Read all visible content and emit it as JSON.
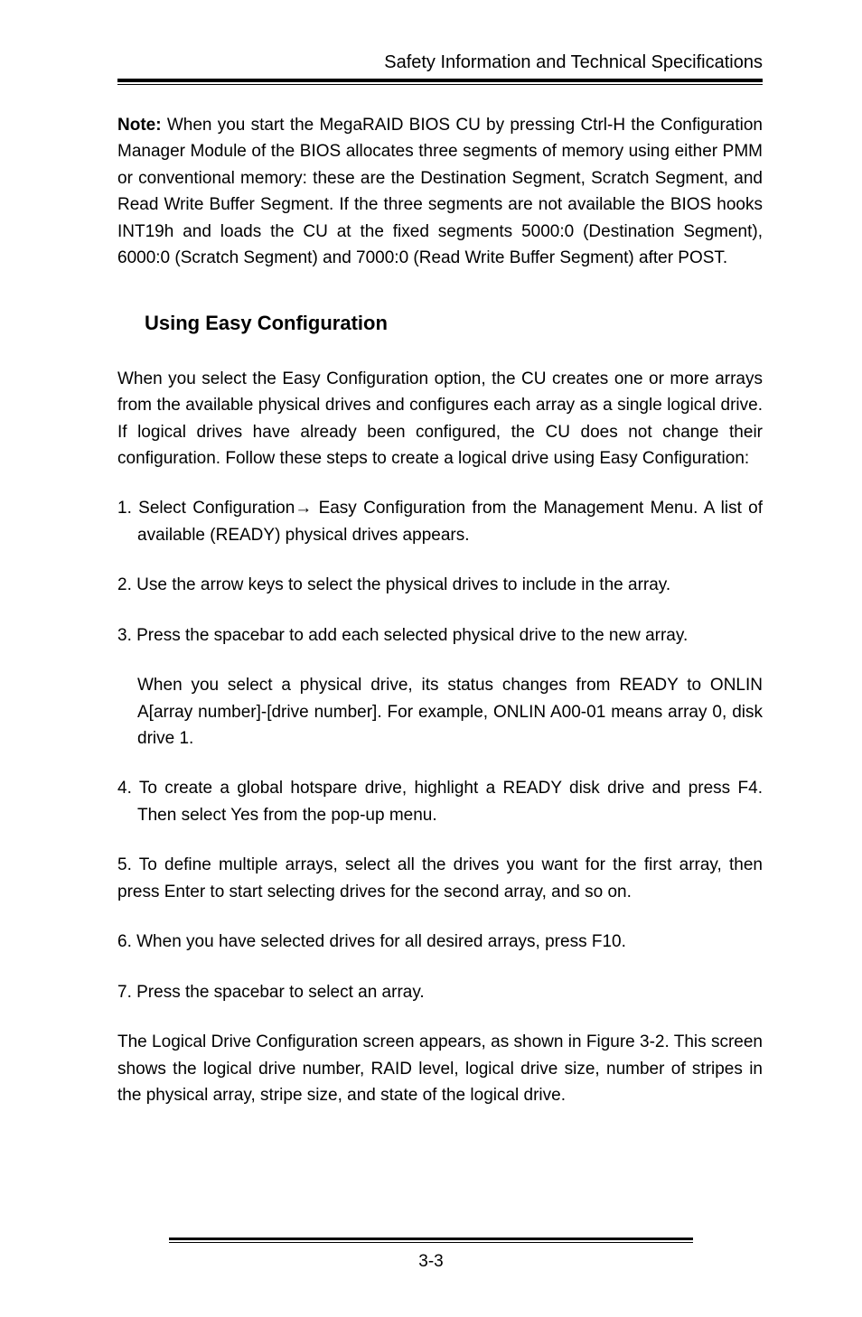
{
  "header": {
    "running_title": "Safety Information and Technical Specifications"
  },
  "note": {
    "label": "Note:",
    "text": " When you start the MegaRAID BIOS CU by pressing Ctrl-H the Configuration Manager Module of the BIOS allocates three segments of memory using either PMM or conventional memory: these are the Destination Segment, Scratch Segment, and Read Write Buffer Segment. If the three segments are not available the BIOS hooks INT19h and loads the CU at the fixed segments 5000:0 (Destination Segment), 6000:0 (Scratch Segment) and 7000:0 (Read Write Buffer Segment) after POST."
  },
  "section": {
    "heading": "Using Easy Configuration",
    "intro": "When you select the Easy Configuration option, the CU creates one or more arrays from the available physical drives and configures each array as a single logical drive. If logical drives have already been configured, the CU does not change their configuration. Follow these steps to create a logical drive using Easy Configuration:",
    "step1": "1. Select Configuration→ Easy Configuration from the Management Menu. A list of available (READY) physical drives appears.",
    "step2": "2. Use the arrow keys to select the physical drives to include in the array.",
    "step3": "3. Press the spacebar to add each selected physical drive to the new array.",
    "step3_sub": "When you select a physical drive, its status changes from READY to ONLIN A[array number]-[drive number]. For example, ONLIN A00-01 means array 0, disk drive 1.",
    "step4": "4. To create a global hotspare drive, highlight a READY disk drive and press F4. Then select Yes from the pop-up menu.",
    "step5": "5. To define multiple arrays, select all the drives you want for the first array, then press Enter to start selecting drives for the second array, and so on.",
    "step6": "6. When you have selected drives for all desired arrays, press F10.",
    "step7": "7. Press the spacebar to select an array.",
    "closing": "The Logical Drive Configuration screen appears, as shown in Figure 3-2. This screen shows the logical drive number, RAID level, logical drive size, number of stripes in the physical array, stripe size, and state of the logical drive."
  },
  "footer": {
    "page_number": "3-3"
  }
}
